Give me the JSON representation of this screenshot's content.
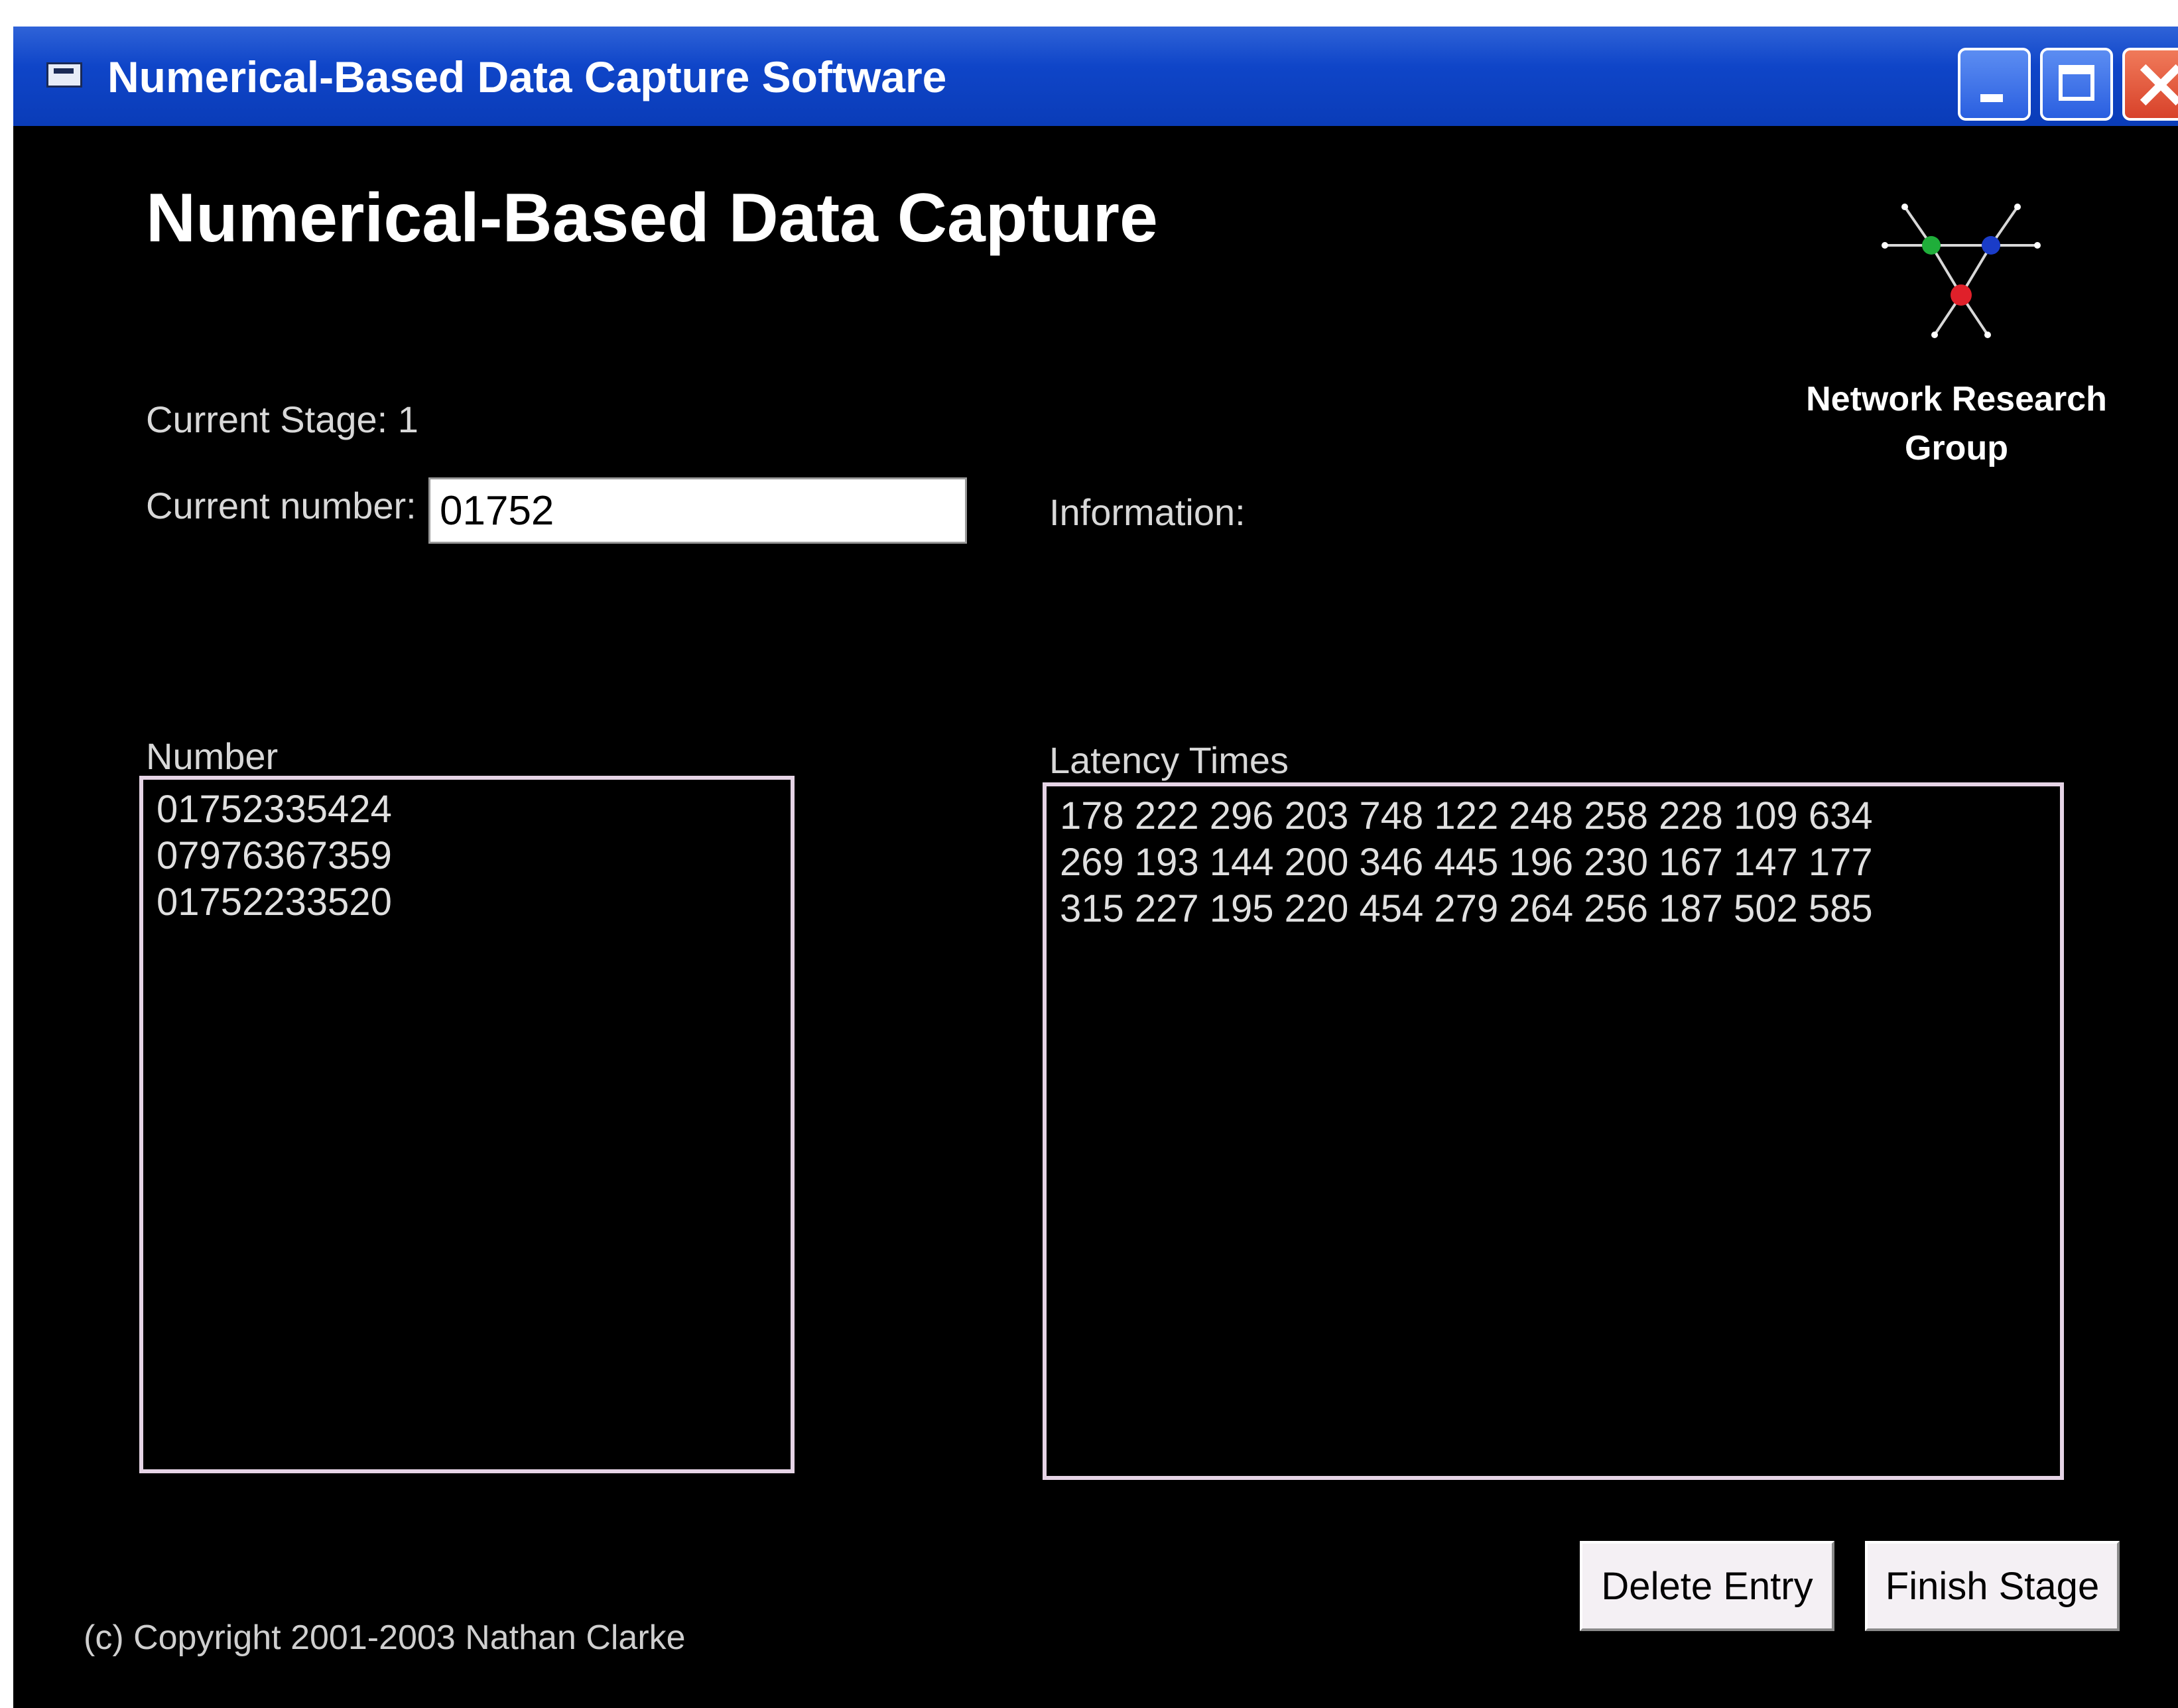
{
  "window": {
    "title": "Numerical-Based Data Capture Software"
  },
  "main": {
    "heading": "Numerical-Based Data Capture",
    "current_stage": "Current Stage: 1",
    "current_number_label": "Current number:",
    "current_number_value": "01752",
    "information_label": "Information:",
    "number_list_label": "Number",
    "latency_list_label": "Latency Times",
    "numbers": [
      "01752335424",
      "07976367359",
      "01752233520"
    ],
    "latencies": [
      "178 222 296 203 748 122 248 258 228 109 634",
      "269 193 144 200 346 445 196 230 167 147 177",
      "315 227 195 220 454 279 264 256 187 502 585"
    ]
  },
  "logo": {
    "line1": "Network Research",
    "line2": "Group",
    "colors": {
      "green": "#1fae3a",
      "blue": "#1a3cc8",
      "red": "#e0202a"
    }
  },
  "buttons": {
    "delete_label": "Delete Entry",
    "finish_label": "Finish Stage"
  },
  "footer": {
    "copyright": "(c) Copyright 2001-2003 Nathan Clarke"
  }
}
